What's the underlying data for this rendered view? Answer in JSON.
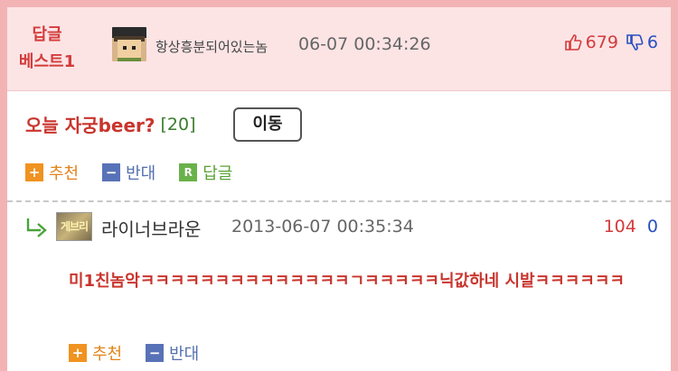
{
  "header": {
    "best_line1": "답글",
    "best_line2": "베스트1",
    "nickname": "항상흥분되어있는놈",
    "datetime": "06-07 00:34:26",
    "upvotes": "679",
    "downvotes": "6"
  },
  "post": {
    "title": "오늘 자궁beer?",
    "comment_count": "[20]",
    "move_button": "이동",
    "actions": {
      "recommend": "추천",
      "oppose": "반대",
      "reply": "답글"
    }
  },
  "reply": {
    "avatar_text": "게브리",
    "nickname": "라이너브라운",
    "datetime": "2013-06-07 00:35:34",
    "upvotes": "104",
    "downvotes": "0",
    "text": "미1친놈악ㅋㅋㅋㅋㅋㅋㅋㅋㅋㅋㅋㅋㅋㅋㄱㅋㅋㅋㅋㅋ닉값하네 시발ㅋㅋㅋㅋㅋㅋ",
    "actions": {
      "recommend": "추천",
      "oppose": "반대"
    }
  },
  "colors": {
    "frame": "#f3b3b5",
    "header_bg": "#fce4e5",
    "accent_red": "#c9352d",
    "accent_blue": "#2a4fbf"
  }
}
